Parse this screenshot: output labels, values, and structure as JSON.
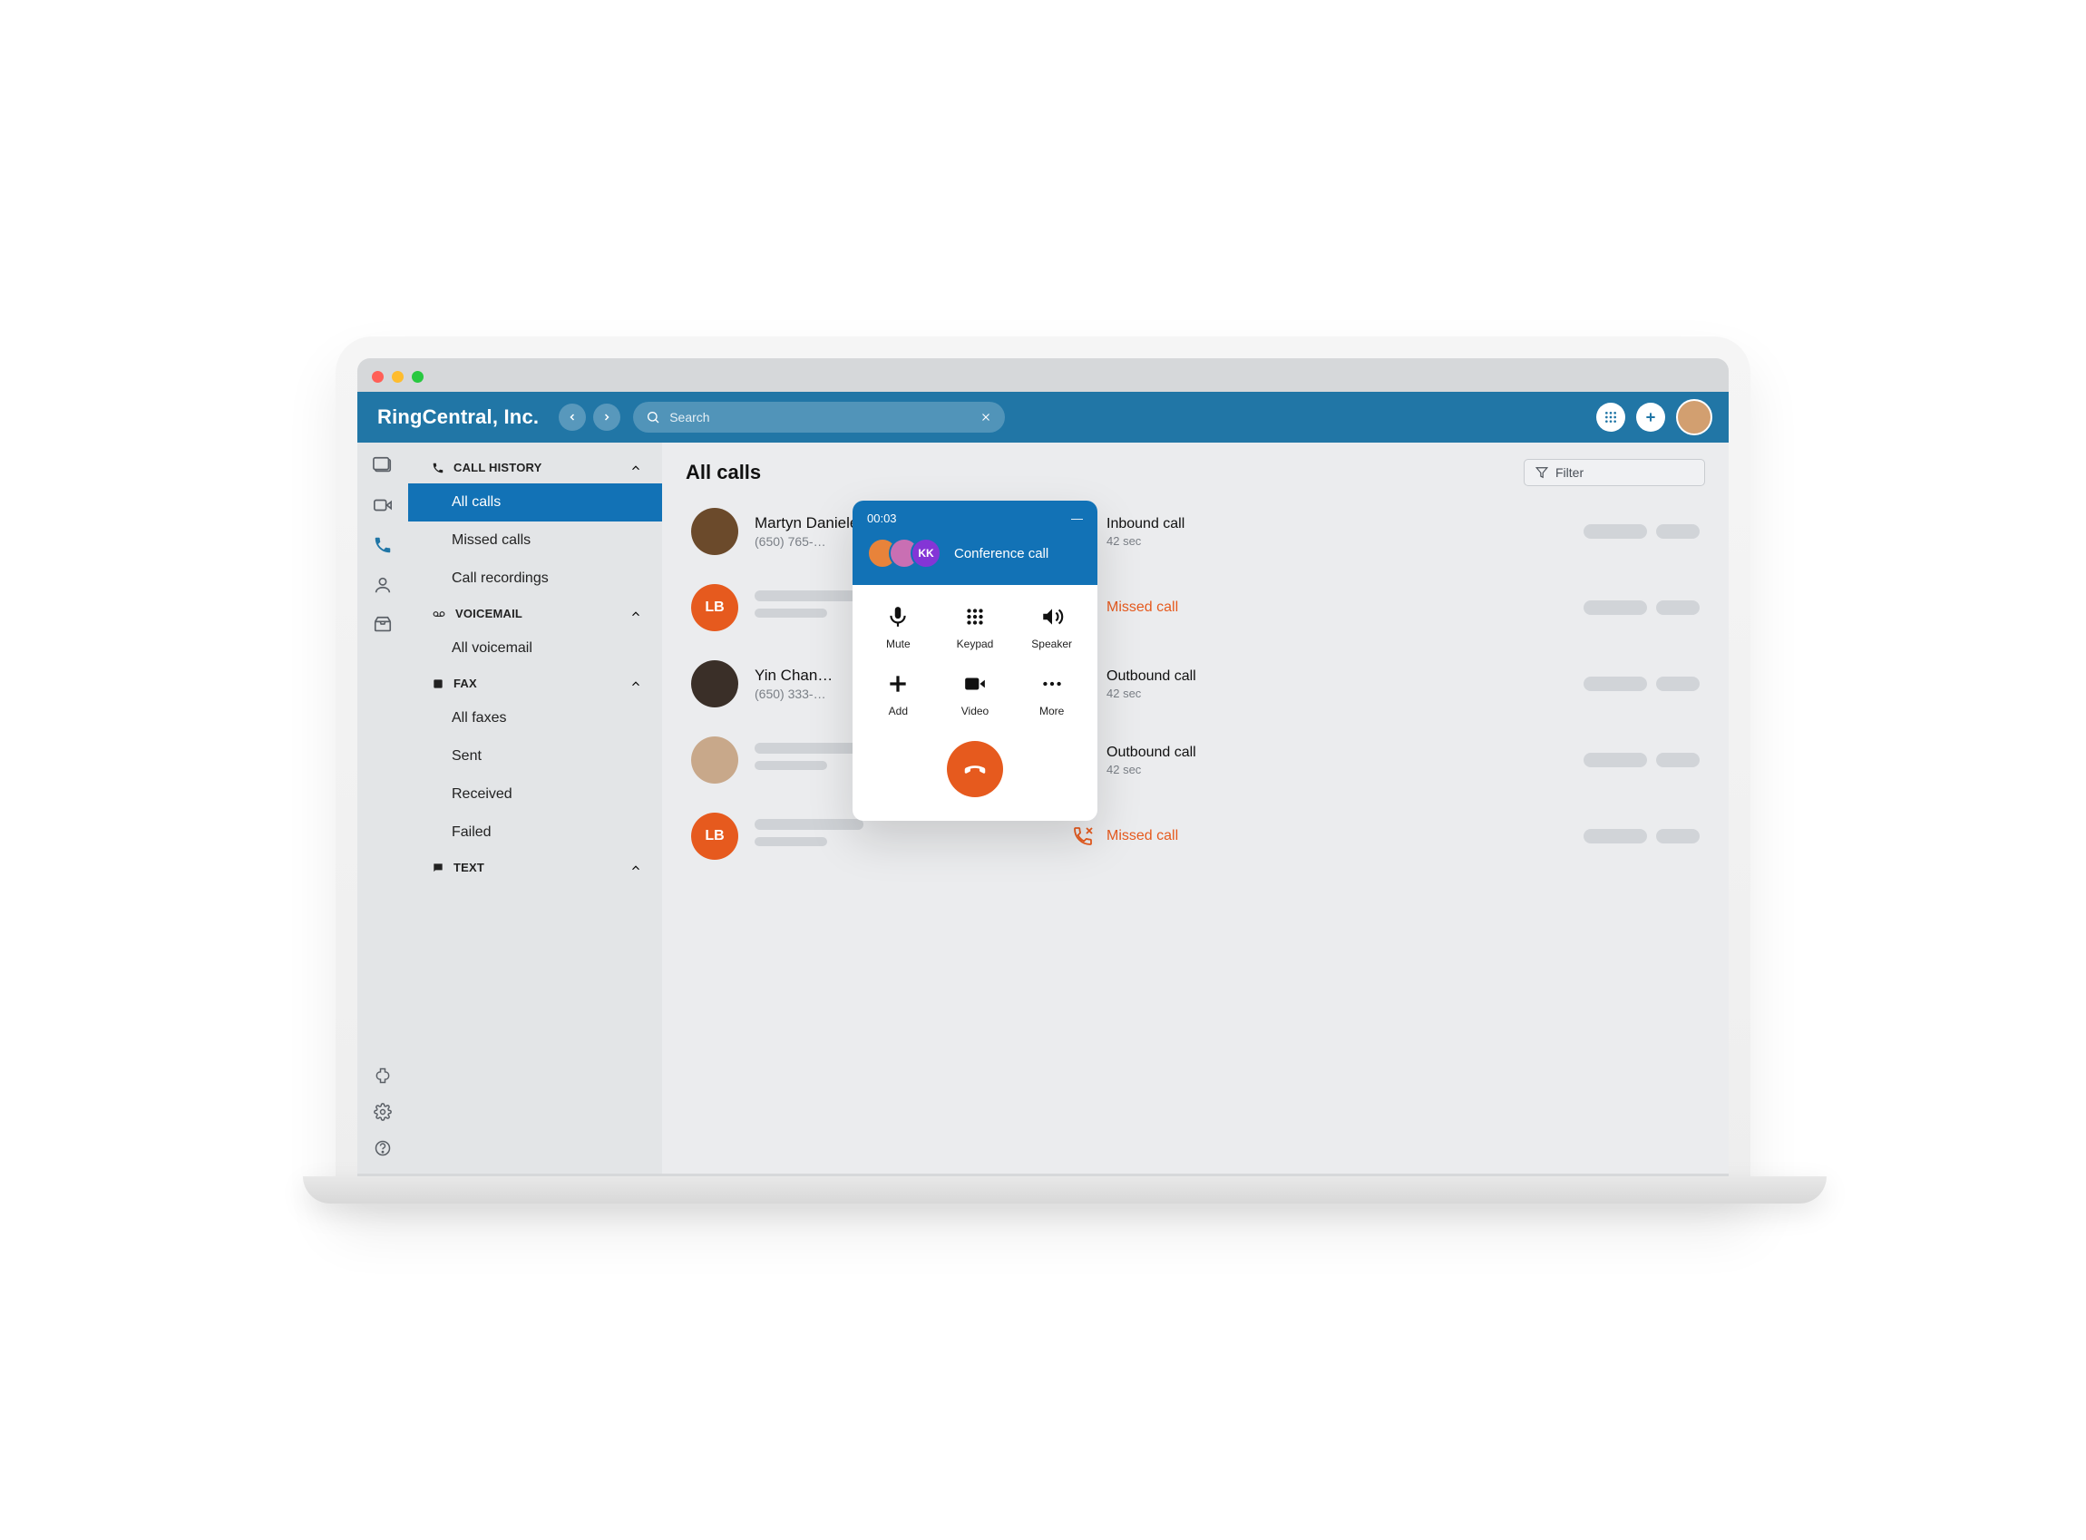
{
  "header": {
    "app_name": "RingCentral, Inc.",
    "search_placeholder": "Search"
  },
  "sidebar": {
    "sections": [
      {
        "title": "CALL HISTORY",
        "items": [
          "All calls",
          "Missed calls",
          "Call recordings"
        ]
      },
      {
        "title": "VOICEMAIL",
        "items": [
          "All voicemail"
        ]
      },
      {
        "title": "FAX",
        "items": [
          "All faxes",
          "Sent",
          "Received",
          "Failed"
        ]
      },
      {
        "title": "TEXT",
        "items": []
      }
    ]
  },
  "main": {
    "title": "All calls",
    "filter_label": "Filter",
    "calls": [
      {
        "name": "Martyn Daniele",
        "phone": "(650) 765-…",
        "type": "Inbound call",
        "duration": "42 sec",
        "missed": false,
        "initials": "",
        "avatar_color": "photo1"
      },
      {
        "name": "",
        "phone": "",
        "type": "Missed call",
        "duration": "",
        "missed": true,
        "initials": "LB",
        "avatar_color": "orange"
      },
      {
        "name": "Yin Chan…",
        "phone": "(650) 333-…",
        "type": "Outbound call",
        "duration": "42 sec",
        "missed": false,
        "initials": "",
        "avatar_color": "photo2"
      },
      {
        "name": "",
        "phone": "",
        "type": "Outbound call",
        "duration": "42 sec",
        "missed": false,
        "initials": "",
        "avatar_color": "photo3"
      },
      {
        "name": "",
        "phone": "",
        "type": "Missed call",
        "duration": "",
        "missed": true,
        "initials": "LB",
        "avatar_color": "orange"
      }
    ]
  },
  "popup": {
    "timer": "00:03",
    "title": "Conference call",
    "participant_initials": "KK",
    "buttons": {
      "mute": "Mute",
      "keypad": "Keypad",
      "speaker": "Speaker",
      "add": "Add",
      "video": "Video",
      "more": "More"
    }
  },
  "colors": {
    "primary": "#1272b6",
    "accent": "#e65a1e"
  }
}
